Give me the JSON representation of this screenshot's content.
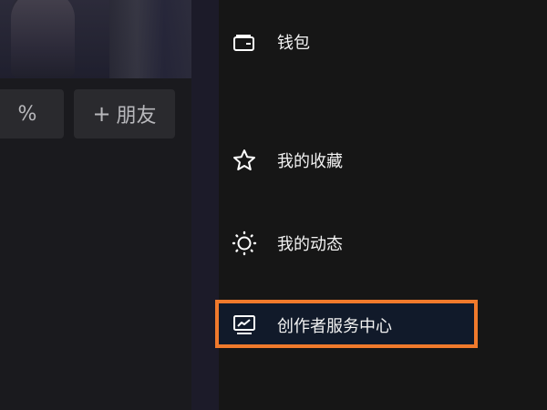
{
  "profile": {
    "chip_partial_text": "%",
    "add_friend_label": "朋友",
    "add_friend_prefix": "+"
  },
  "menu": {
    "items": [
      {
        "label": "钱包",
        "icon": "wallet-icon"
      },
      {
        "label": "我的收藏",
        "icon": "star-icon"
      },
      {
        "label": "我的动态",
        "icon": "sun-icon"
      },
      {
        "label": "创作者服务中心",
        "icon": "monitor-chart-icon",
        "highlighted": true
      }
    ]
  },
  "colors": {
    "highlight_border": "#f07a2c",
    "background": "#161616"
  }
}
